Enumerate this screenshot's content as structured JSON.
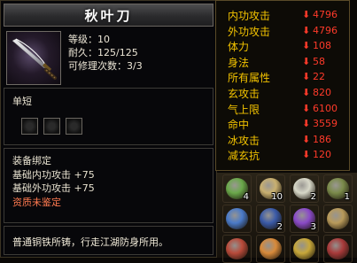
{
  "item": {
    "name": "秋叶刀",
    "stats": [
      "等级：10",
      "耐久：125/125",
      "可修理次数：3/3"
    ],
    "weapon_type": "单短",
    "gem_slots": 3,
    "bind_status": "装备绑定",
    "bonuses": [
      "基础内功攻击 +75",
      "基础外功攻击 +75"
    ],
    "quality": "资质未鉴定",
    "description": "普通铜铁所铸，行走江湖防身所用。"
  },
  "attributes": [
    {
      "name": "内功攻击",
      "value": "4796"
    },
    {
      "name": "外功攻击",
      "value": "4796"
    },
    {
      "name": "体力",
      "value": "108"
    },
    {
      "name": "身法",
      "value": "58"
    },
    {
      "name": "所有属性",
      "value": "22"
    },
    {
      "name": "玄攻击",
      "value": "820"
    },
    {
      "name": "气上限",
      "value": "6100"
    },
    {
      "name": "命中",
      "value": "3559"
    },
    {
      "name": "冰攻击",
      "value": "186"
    },
    {
      "name": "减玄抗",
      "value": "120"
    }
  ],
  "inventory": [
    {
      "icon": "green-orb-icon",
      "count": "4",
      "color": "#6aa84a"
    },
    {
      "icon": "gift-box-icon",
      "count": "10",
      "color": "#c9b070"
    },
    {
      "icon": "white-flower-icon",
      "count": "2",
      "color": "#d8d8c8"
    },
    {
      "icon": "herb-icon",
      "count": "1",
      "color": "#7a8a4a"
    },
    {
      "icon": "water-flask-icon",
      "count": "",
      "color": "#4a7ac8"
    },
    {
      "icon": "blue-pouch-icon",
      "count": "2",
      "color": "#3a5aa8"
    },
    {
      "icon": "treasure-chest-icon",
      "count": "3",
      "color": "#8a4ac8"
    },
    {
      "icon": "bowl-icon",
      "count": "",
      "color": "#b89a5a"
    },
    {
      "icon": "red-charm-icon",
      "count": "",
      "color": "#b84a3a"
    },
    {
      "icon": "tiger-icon",
      "count": "",
      "color": "#d88a3a"
    },
    {
      "icon": "golden-ring-icon",
      "count": "",
      "color": "#c8a83a"
    },
    {
      "icon": "red-box-icon",
      "count": "",
      "color": "#a83a3a"
    }
  ]
}
